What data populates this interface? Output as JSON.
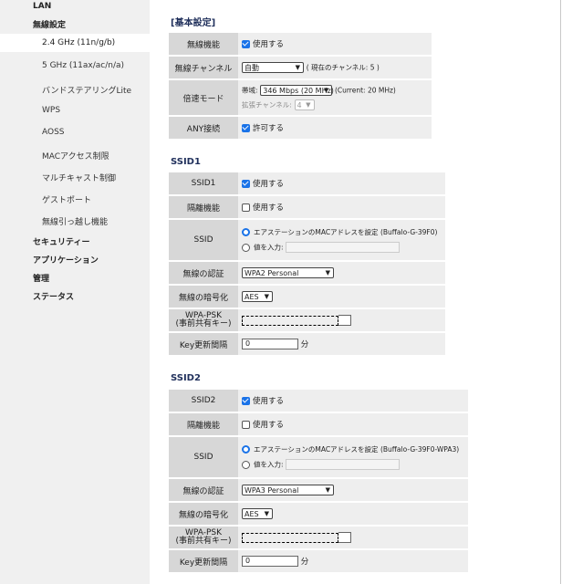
{
  "sidebar": {
    "top": [
      {
        "label": "LAN"
      },
      {
        "label": "無線設定"
      }
    ],
    "sub": [
      {
        "label": "2.4 GHz (11n/g/b)"
      },
      {
        "label": "5 GHz (11ax/ac/n/a)"
      },
      {
        "label": "バンドステアリングLite"
      },
      {
        "label": "WPS"
      },
      {
        "label": "AOSS"
      },
      {
        "label": "MACアクセス制限"
      },
      {
        "label": "マルチキャスト制御"
      },
      {
        "label": "ゲストポート"
      },
      {
        "label": "無線引っ越し機能"
      }
    ],
    "bottom": [
      {
        "label": "セキュリティー"
      },
      {
        "label": "アプリケーション"
      },
      {
        "label": "管理"
      },
      {
        "label": "ステータス"
      }
    ]
  },
  "basic": {
    "title": "[基本設定]",
    "wireless_label": "無線機能",
    "wireless_value": "使用する",
    "channel_label": "無線チャンネル",
    "channel_value": "自動",
    "channel_current": "( 現在のチャンネル: 5 )",
    "speed_label": "倍速モード",
    "bandwidth_prefix": "帯域:",
    "bandwidth_value": "346 Mbps (20 MHz)",
    "bandwidth_current": "(Current: 20 MHz)",
    "ext_channel_label": "拡張チャンネル:",
    "ext_channel_value": "4",
    "any_label": "ANY接続",
    "any_value": "許可する"
  },
  "ssid1": {
    "title": "SSID1",
    "ssid_label": "SSID1",
    "ssid_value": "使用する",
    "isolation_label": "隔離機能",
    "isolation_value": "使用する",
    "ssid_row_label": "SSID",
    "mac_option": "エアステーションのMACアドレスを設定 (Buffalo-G-39F0)",
    "custom_option": "値を入力:",
    "auth_label": "無線の認証",
    "auth_value": "WPA2 Personal",
    "enc_label": "無線の暗号化",
    "enc_value": "AES",
    "psk_label_1": "WPA-PSK",
    "psk_label_2": "(事前共有キー)",
    "key_label": "Key更新間隔",
    "key_value": "0",
    "key_unit": "分"
  },
  "ssid2": {
    "title": "SSID2",
    "ssid_label": "SSID2",
    "ssid_value": "使用する",
    "isolation_label": "隔離機能",
    "isolation_value": "使用する",
    "ssid_row_label": "SSID",
    "mac_option": "エアステーションのMACアドレスを設定 (Buffalo-G-39F0-WPA3)",
    "custom_option": "値を入力:",
    "auth_label": "無線の認証",
    "auth_value": "WPA3 Personal",
    "enc_label": "無線の暗号化",
    "enc_value": "AES",
    "psk_label_1": "WPA-PSK",
    "psk_label_2": "(事前共有キー)",
    "key_label": "Key更新間隔",
    "key_value": "0",
    "key_unit": "分"
  },
  "colors": {
    "accent": "#1a73e8",
    "label_bg": "#d7d7d7",
    "value_bg": "#eeeeee",
    "sidebar_bg": "#f0f0f0"
  }
}
